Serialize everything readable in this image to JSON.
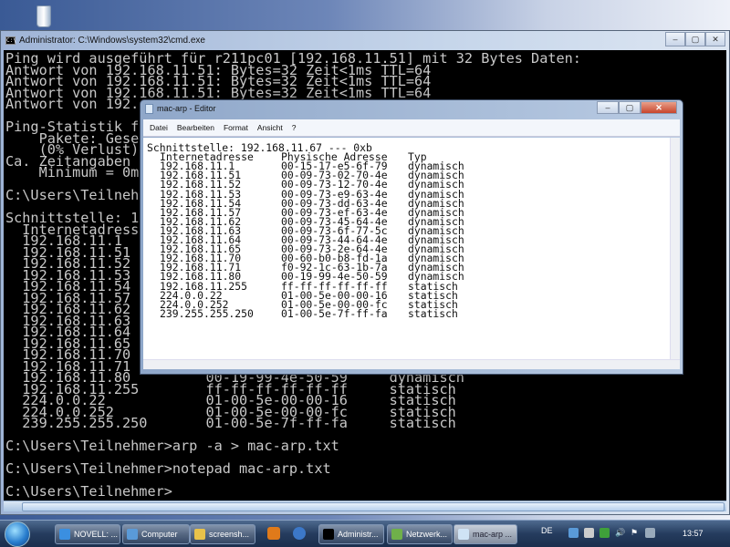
{
  "desktop": {
    "icons": [
      "recycle-bin-icon"
    ]
  },
  "cmd": {
    "title": "Administrator: C:\\Windows\\system32\\cmd.exe",
    "icon_text": "C:\\",
    "lines": [
      "Ping wird ausgeführt für r211pc01 [192.168.11.51] mit 32 Bytes Daten:",
      "Antwort von 192.168.11.51: Bytes=32 Zeit<1ms TTL=64",
      "Antwort von 192.168.11.51: Bytes=32 Zeit<1ms TTL=64",
      "Antwort von 192.168.11.51: Bytes=32 Zeit<1ms TTL=64",
      "Antwort von 192.",
      "",
      "Ping-Statistik f",
      "    Pakete: Gese",
      "    (0% Verlust)",
      "Ca. Zeitangaben",
      "    Minimum = 0m",
      "",
      "C:\\Users\\Teilneh",
      "",
      "Schnittstelle: 1",
      "  Internetadress",
      "  192.168.11.1",
      "  192.168.11.51",
      "  192.168.11.52",
      "  192.168.11.53",
      "  192.168.11.54",
      "  192.168.11.57",
      "  192.168.11.62",
      "  192.168.11.63",
      "  192.168.11.64",
      "  192.168.11.65",
      "  192.168.11.70",
      "  192.168.11.71",
      "  192.168.11.80         00-19-99-4e-50-59     dynamisch",
      "  192.168.11.255        ff-ff-ff-ff-ff-ff     statisch",
      "  224.0.0.22            01-00-5e-00-00-16     statisch",
      "  224.0.0.252           01-00-5e-00-00-fc     statisch",
      "  239.255.255.250       01-00-5e-7f-ff-fa     statisch",
      "",
      "C:\\Users\\Teilnehmer>arp -a > mac-arp.txt",
      "",
      "C:\\Users\\Teilnehmer>notepad mac-arp.txt",
      "",
      "C:\\Users\\Teilnehmer>"
    ]
  },
  "notepad": {
    "title": "mac-arp - Editor",
    "menu": [
      "Datei",
      "Bearbeiten",
      "Format",
      "Ansicht",
      "?"
    ],
    "interface_line": "Schnittstelle: 192.168.11.67 --- 0xb",
    "headers": [
      "Internetadresse",
      "Physische Adresse",
      "Typ"
    ],
    "rows": [
      [
        "192.168.11.1",
        "00-15-17-e5-6f-79",
        "dynamisch"
      ],
      [
        "192.168.11.51",
        "00-09-73-02-70-4e",
        "dynamisch"
      ],
      [
        "192.168.11.52",
        "00-09-73-12-70-4e",
        "dynamisch"
      ],
      [
        "192.168.11.53",
        "00-09-73-e9-63-4e",
        "dynamisch"
      ],
      [
        "192.168.11.54",
        "00-09-73-dd-63-4e",
        "dynamisch"
      ],
      [
        "192.168.11.57",
        "00-09-73-ef-63-4e",
        "dynamisch"
      ],
      [
        "192.168.11.62",
        "00-09-73-45-64-4e",
        "dynamisch"
      ],
      [
        "192.168.11.63",
        "00-09-73-6f-77-5c",
        "dynamisch"
      ],
      [
        "192.168.11.64",
        "00-09-73-44-64-4e",
        "dynamisch"
      ],
      [
        "192.168.11.65",
        "00-09-73-2e-64-4e",
        "dynamisch"
      ],
      [
        "192.168.11.70",
        "00-60-b0-b8-fd-1a",
        "dynamisch"
      ],
      [
        "192.168.11.71",
        "f0-92-1c-63-1b-7a",
        "dynamisch"
      ],
      [
        "192.168.11.80",
        "00-19-99-4e-50-59",
        "dynamisch"
      ],
      [
        "192.168.11.255",
        "ff-ff-ff-ff-ff-ff",
        "statisch"
      ],
      [
        "224.0.0.22",
        "01-00-5e-00-00-16",
        "statisch"
      ],
      [
        "224.0.0.252",
        "01-00-5e-00-00-fc",
        "statisch"
      ],
      [
        "239.255.255.250",
        "01-00-5e-7f-ff-fa",
        "statisch"
      ]
    ]
  },
  "taskbar": {
    "buttons": [
      {
        "label": "NOVELL: ...",
        "icon": "internet-explorer-icon",
        "color": "#3b8fe0"
      },
      {
        "label": "Computer",
        "icon": "computer-icon",
        "color": "#5a9ad8"
      },
      {
        "label": "screensh...",
        "icon": "folder-icon",
        "color": "#e8c24a"
      },
      {
        "label": "Administr...",
        "icon": "cmd-icon",
        "color": "#000000"
      },
      {
        "label": "Netzwerk...",
        "icon": "network-icon",
        "color": "#6fb04a"
      },
      {
        "label": "mac-arp ...",
        "icon": "notepad-icon",
        "color": "#cfe3f5"
      }
    ],
    "language": "DE",
    "clock": "13:57"
  }
}
